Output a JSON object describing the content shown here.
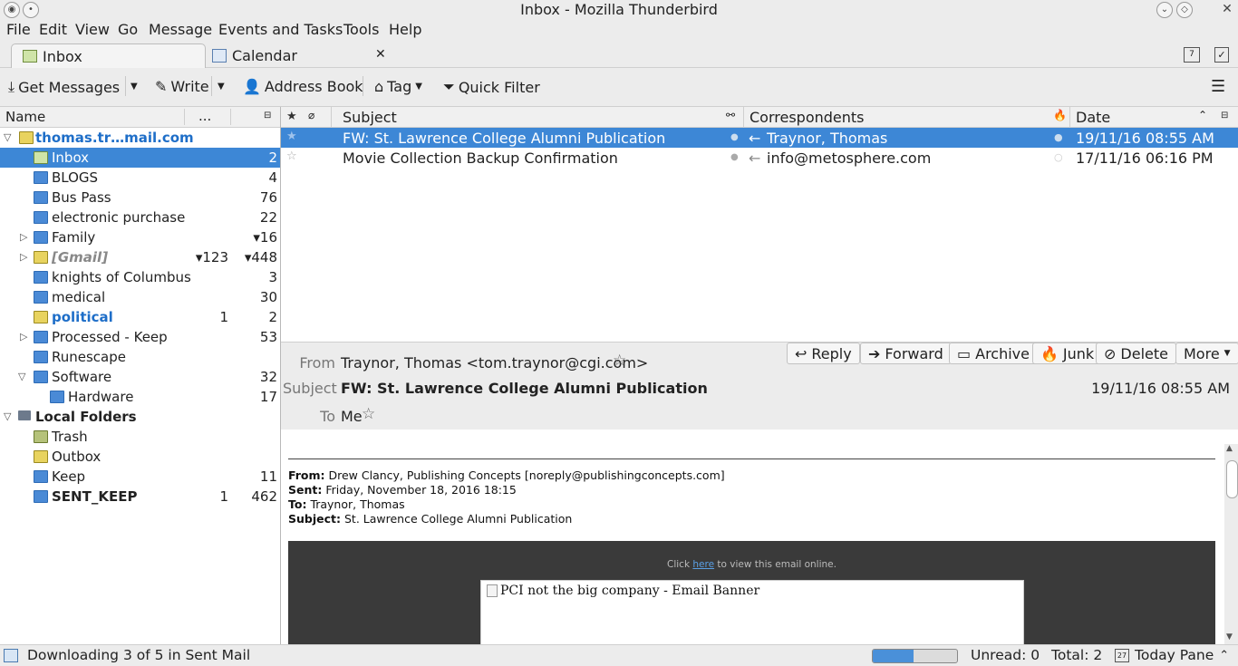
{
  "window": {
    "title": "Inbox - Mozilla Thunderbird"
  },
  "menu": [
    "File",
    "Edit",
    "View",
    "Go",
    "Message",
    "Events and Tasks",
    "Tools",
    "Help"
  ],
  "tabs": [
    {
      "label": "Inbox"
    },
    {
      "label": "Calendar"
    }
  ],
  "toolbar": {
    "get_messages": "Get Messages",
    "write": "Write",
    "address_book": "Address Book",
    "tag": "Tag",
    "quick_filter": "Quick Filter"
  },
  "folder_pane": {
    "col_name": "Name",
    "col_unread": "...",
    "folders": [
      {
        "name": "thomas.tr…mail.com",
        "unread": "",
        "total": ""
      },
      {
        "name": "Inbox",
        "unread": "",
        "total": "2"
      },
      {
        "name": "BLOGS",
        "unread": "",
        "total": "4"
      },
      {
        "name": "Bus Pass",
        "unread": "",
        "total": "76"
      },
      {
        "name": "electronic purchase",
        "unread": "",
        "total": "22"
      },
      {
        "name": "Family",
        "unread": "",
        "total": "▾16"
      },
      {
        "name": "[Gmail]",
        "unread": "▾123",
        "total": "▾448"
      },
      {
        "name": "knights of Columbus",
        "unread": "",
        "total": "3"
      },
      {
        "name": "medical",
        "unread": "",
        "total": "30"
      },
      {
        "name": "political",
        "unread": "1",
        "total": "2"
      },
      {
        "name": "Processed - Keep",
        "unread": "",
        "total": "53"
      },
      {
        "name": "Runescape",
        "unread": "",
        "total": ""
      },
      {
        "name": "Software",
        "unread": "",
        "total": "32"
      },
      {
        "name": "Hardware",
        "unread": "",
        "total": "17"
      },
      {
        "name": "Local Folders",
        "unread": "",
        "total": ""
      },
      {
        "name": "Trash",
        "unread": "",
        "total": ""
      },
      {
        "name": "Outbox",
        "unread": "",
        "total": ""
      },
      {
        "name": "Keep",
        "unread": "",
        "total": "11"
      },
      {
        "name": "SENT_KEEP",
        "unread": "1",
        "total": "462"
      }
    ]
  },
  "thread_pane": {
    "col_subject": "Subject",
    "col_correspondents": "Correspondents",
    "col_date": "Date",
    "messages": [
      {
        "subject": "FW: St. Lawrence College Alumni Publication",
        "correspondent": "Traynor, Thomas",
        "date": "19/11/16 08:55 AM"
      },
      {
        "subject": "Movie Collection Backup Confirmation",
        "correspondent": "info@metosphere.com",
        "date": "17/11/16 06:16 PM"
      }
    ]
  },
  "message_header": {
    "from_label": "From",
    "from_value": "Traynor, Thomas <tom.traynor@cgi.com>",
    "subject_label": "Subject",
    "subject_value": "FW: St. Lawrence College Alumni Publication",
    "to_label": "To",
    "to_value": "Me",
    "date": "19/11/16 08:55 AM",
    "actions": {
      "reply": "Reply",
      "forward": "Forward",
      "archive": "Archive",
      "junk": "Junk",
      "delete": "Delete",
      "more": "More"
    }
  },
  "message_body": {
    "from_label": "From:",
    "from_value": "Drew Clancy, Publishing Concepts [noreply@publishingconcepts.com]",
    "sent_label": "Sent:",
    "sent_value": "Friday, November 18, 2016 18:15",
    "to_label": "To:",
    "to_value": "Traynor, Thomas",
    "subject_label": "Subject:",
    "subject_value": "St. Lawrence College Alumni Publication",
    "click_pre": "Click",
    "click_link": "here",
    "click_post": "to view this email online.",
    "banner_alt": "PCI not the big company - Email Banner"
  },
  "statusbar": {
    "status": "Downloading 3 of 5 in Sent Mail",
    "progress": 0.48,
    "unread": "Unread: 0",
    "total": "Total: 2",
    "today_pane": "Today Pane"
  }
}
